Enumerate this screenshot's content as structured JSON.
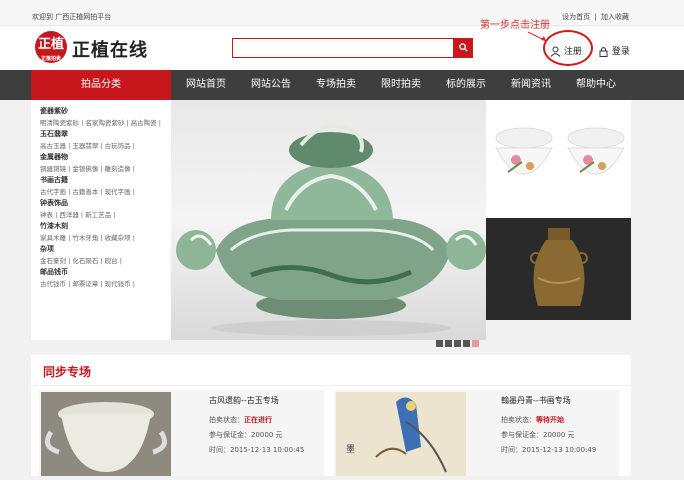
{
  "topbar": {
    "welcome": "欢迎到 广西正植网拍平台",
    "set_home": "设为首页",
    "separator": "|",
    "add_fav": "加入收藏"
  },
  "header": {
    "logo_text": "正植",
    "logo_sub": "正植拍卖",
    "brand": "正植在线",
    "search_placeholder": "",
    "register": "注册",
    "login": "登录",
    "annotation": "第一步点击注册"
  },
  "nav": {
    "category": "拍品分类",
    "items": [
      "网站首页",
      "网站公告",
      "专场拍卖",
      "限时拍卖",
      "标的展示",
      "新闻资讯",
      "帮助中心"
    ]
  },
  "sidebar": {
    "categories": [
      {
        "title": "瓷器紫砂",
        "subs": "明清陶瓷紫砂 | 名家陶瓷紫砂 | 高古陶瓷 |"
      },
      {
        "title": "玉石翡翠",
        "subs": "高古玉器 | 玉器翡翠 | 古玩饰品 |"
      },
      {
        "title": "金属器物",
        "subs": "铜器铜镜 | 金银佛像 | 雕刻造像 |"
      },
      {
        "title": "书画古籍",
        "subs": "古代字画 | 古籍善本 | 现代字画 |"
      },
      {
        "title": "钟表饰品",
        "subs": "钟表 | 西洋器 | 新工艺品 |"
      },
      {
        "title": "竹漆木刻",
        "subs": "家具木雕 | 竹木牙角 | 收藏杂项 |"
      },
      {
        "title": "杂项",
        "subs": "金石篆刻 | 化石陨石 | 砚台 |"
      },
      {
        "title": "邮品钱币",
        "subs": "古代钱币 | 邮票证章 | 现代钱币 |"
      }
    ]
  },
  "section": {
    "title": "同步专场",
    "cards": [
      {
        "name": "古风遗韵--古玉专场",
        "status_label": "拍卖状态：",
        "status": "正在进行",
        "deposit": "参与保证金：20000 元",
        "time": "时间：2015-12-13 10:00:45"
      },
      {
        "name": "翰墨丹青--书画专场",
        "status_label": "拍卖状态：",
        "status": "等待开始",
        "deposit": "参与保证金：20000 元",
        "time": "时间：2015-12-13 10:00:49"
      }
    ]
  },
  "colors": {
    "accent": "#c8161d",
    "nav_bg": "#3e3e3e"
  }
}
